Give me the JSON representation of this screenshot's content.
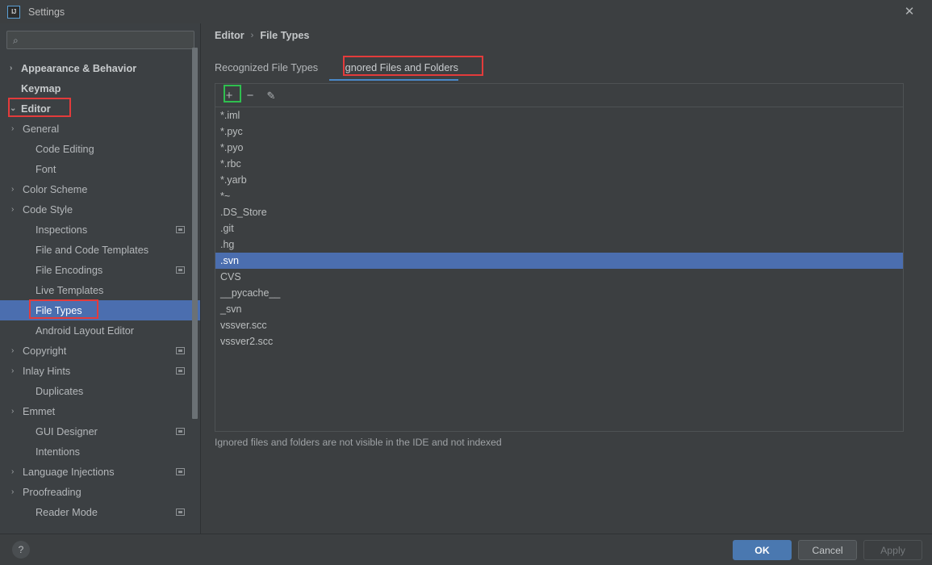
{
  "window": {
    "title": "Settings",
    "logo_text": "IJ",
    "close_icon": "✕"
  },
  "search": {
    "placeholder": "",
    "value": "",
    "icon": "search-icon",
    "glyph": "⌕"
  },
  "sidebar": {
    "items": [
      {
        "label": "Appearance & Behavior",
        "indent": 0,
        "arrow": "›",
        "bold": true,
        "selected": false,
        "badge": false
      },
      {
        "label": "Keymap",
        "indent": 0,
        "arrow": "",
        "bold": true,
        "selected": false,
        "badge": false
      },
      {
        "label": "Editor",
        "indent": 0,
        "arrow": "⌄",
        "bold": true,
        "selected": false,
        "badge": false
      },
      {
        "label": "General",
        "indent": 1,
        "arrow": "›",
        "bold": false,
        "selected": false,
        "badge": false
      },
      {
        "label": "Code Editing",
        "indent": 2,
        "arrow": "",
        "bold": false,
        "selected": false,
        "badge": false
      },
      {
        "label": "Font",
        "indent": 2,
        "arrow": "",
        "bold": false,
        "selected": false,
        "badge": false
      },
      {
        "label": "Color Scheme",
        "indent": 1,
        "arrow": "›",
        "bold": false,
        "selected": false,
        "badge": false
      },
      {
        "label": "Code Style",
        "indent": 1,
        "arrow": "›",
        "bold": false,
        "selected": false,
        "badge": false
      },
      {
        "label": "Inspections",
        "indent": 2,
        "arrow": "",
        "bold": false,
        "selected": false,
        "badge": true
      },
      {
        "label": "File and Code Templates",
        "indent": 2,
        "arrow": "",
        "bold": false,
        "selected": false,
        "badge": false
      },
      {
        "label": "File Encodings",
        "indent": 2,
        "arrow": "",
        "bold": false,
        "selected": false,
        "badge": true
      },
      {
        "label": "Live Templates",
        "indent": 2,
        "arrow": "",
        "bold": false,
        "selected": false,
        "badge": false
      },
      {
        "label": "File Types",
        "indent": 2,
        "arrow": "",
        "bold": false,
        "selected": true,
        "badge": false
      },
      {
        "label": "Android Layout Editor",
        "indent": 2,
        "arrow": "",
        "bold": false,
        "selected": false,
        "badge": false
      },
      {
        "label": "Copyright",
        "indent": 1,
        "arrow": "›",
        "bold": false,
        "selected": false,
        "badge": true
      },
      {
        "label": "Inlay Hints",
        "indent": 1,
        "arrow": "›",
        "bold": false,
        "selected": false,
        "badge": true
      },
      {
        "label": "Duplicates",
        "indent": 2,
        "arrow": "",
        "bold": false,
        "selected": false,
        "badge": false
      },
      {
        "label": "Emmet",
        "indent": 1,
        "arrow": "›",
        "bold": false,
        "selected": false,
        "badge": false
      },
      {
        "label": "GUI Designer",
        "indent": 2,
        "arrow": "",
        "bold": false,
        "selected": false,
        "badge": true
      },
      {
        "label": "Intentions",
        "indent": 2,
        "arrow": "",
        "bold": false,
        "selected": false,
        "badge": false
      },
      {
        "label": "Language Injections",
        "indent": 1,
        "arrow": "›",
        "bold": false,
        "selected": false,
        "badge": true
      },
      {
        "label": "Proofreading",
        "indent": 1,
        "arrow": "›",
        "bold": false,
        "selected": false,
        "badge": false
      },
      {
        "label": "Reader Mode",
        "indent": 2,
        "arrow": "",
        "bold": false,
        "selected": false,
        "badge": true
      }
    ]
  },
  "breadcrumb": {
    "root": "Editor",
    "separator": "›",
    "leaf": "File Types"
  },
  "tabs": [
    {
      "label": "Recognized File Types",
      "active": false
    },
    {
      "label": "Ignored Files and Folders",
      "active": true
    }
  ],
  "toolbar": {
    "add_label": "+",
    "remove_label": "−",
    "edit_label": "✎"
  },
  "ignored_list": {
    "items": [
      {
        "value": "*.iml",
        "selected": false
      },
      {
        "value": "*.pyc",
        "selected": false
      },
      {
        "value": "*.pyo",
        "selected": false
      },
      {
        "value": "*.rbc",
        "selected": false
      },
      {
        "value": "*.yarb",
        "selected": false
      },
      {
        "value": "*~",
        "selected": false
      },
      {
        "value": ".DS_Store",
        "selected": false
      },
      {
        "value": ".git",
        "selected": false
      },
      {
        "value": ".hg",
        "selected": false
      },
      {
        "value": ".svn",
        "selected": true
      },
      {
        "value": "CVS",
        "selected": false
      },
      {
        "value": "__pycache__",
        "selected": false
      },
      {
        "value": "_svn",
        "selected": false
      },
      {
        "value": "vssver.scc",
        "selected": false
      },
      {
        "value": "vssver2.scc",
        "selected": false
      }
    ]
  },
  "hint": "Ignored files and folders are not visible in the IDE and not indexed",
  "footer": {
    "help_label": "?",
    "ok_label": "OK",
    "cancel_label": "Cancel",
    "apply_label": "Apply"
  },
  "colors": {
    "accent": "#4b6eaf",
    "tab_underline": "#4a88c7",
    "annotation_red": "#e33b3b",
    "annotation_green": "#2fbf4f",
    "background": "#3c3f41",
    "sidebar_background": "#3c4043"
  }
}
